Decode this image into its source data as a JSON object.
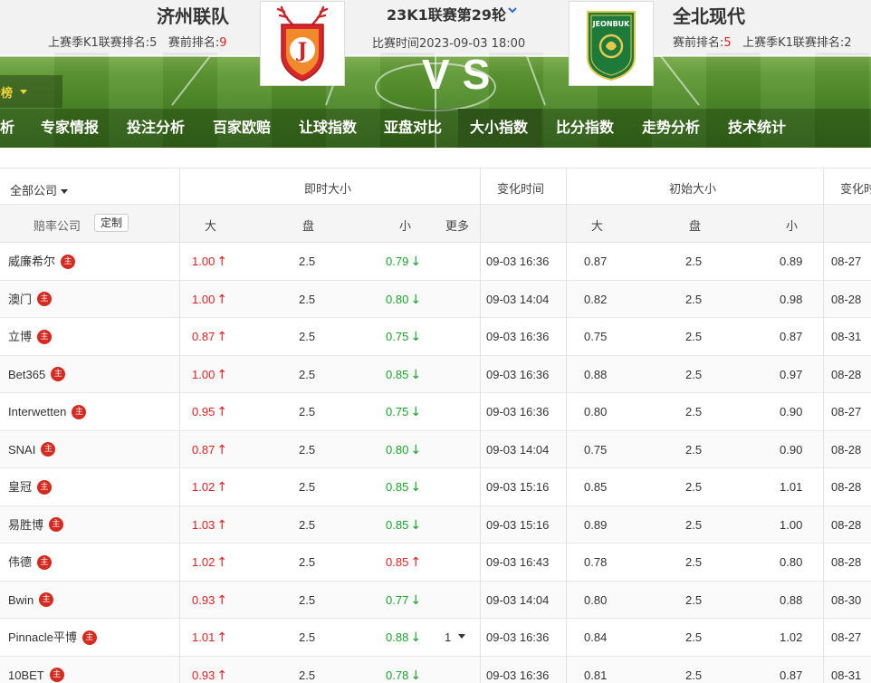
{
  "match": {
    "home_team": "济州联队",
    "away_team": "全北现代",
    "home_rank_prefix": "上赛季K1联赛排名:5",
    "home_rank_label": "赛前排名:",
    "home_rank_value": "9",
    "away_rank_label": "赛前排名:",
    "away_rank_value": "5",
    "away_rank_suffix": "上赛季K1联赛排名:2",
    "league_round": "23K1联赛第29轮",
    "match_time": "比赛时间2023-09-03 18:00",
    "vs": "VS",
    "home_logo_text": "J",
    "away_logo_text": "JEONBUK"
  },
  "rank_tab": {
    "label": "分榜"
  },
  "nav": {
    "items": [
      {
        "label": "析",
        "active": false
      },
      {
        "label": "专家情报",
        "active": false
      },
      {
        "label": "投注分析",
        "active": false
      },
      {
        "label": "百家欧赔",
        "active": false
      },
      {
        "label": "让球指数",
        "active": false
      },
      {
        "label": "亚盘对比",
        "active": false
      },
      {
        "label": "大小指数",
        "active": true
      },
      {
        "label": "比分指数",
        "active": false
      },
      {
        "label": "走势分析",
        "active": false
      },
      {
        "label": "技术统计",
        "active": false
      }
    ]
  },
  "table": {
    "company_filter": "全部公司",
    "live_header": "即时大小",
    "change_time_header": "变化时间",
    "initial_header": "初始大小",
    "initial_change_header": "变化时",
    "odds_company_label": "赔率公司",
    "customize_label": "定制",
    "sub_big": "大",
    "sub_line": "盘",
    "sub_small": "小",
    "sub_more": "更多",
    "sub_ibig": "大",
    "sub_iline": "盘",
    "sub_ismall": "小",
    "badge_label": "主",
    "rows": [
      {
        "company": "威廉希尔",
        "big": "1.00",
        "big_dir": "up",
        "line": "2.5",
        "small": "0.79",
        "small_dir": "down",
        "more": "",
        "time": "09-03 16:36",
        "ibig": "0.87",
        "iline": "2.5",
        "ismall": "0.89",
        "itime": "08-27"
      },
      {
        "company": "澳门",
        "big": "1.00",
        "big_dir": "up",
        "line": "2.5",
        "small": "0.80",
        "small_dir": "down",
        "more": "",
        "time": "09-03 14:04",
        "ibig": "0.82",
        "iline": "2.5",
        "ismall": "0.98",
        "itime": "08-28"
      },
      {
        "company": "立博",
        "big": "0.87",
        "big_dir": "up",
        "line": "2.5",
        "small": "0.75",
        "small_dir": "down",
        "more": "",
        "time": "09-03 16:36",
        "ibig": "0.75",
        "iline": "2.5",
        "ismall": "0.87",
        "itime": "08-31"
      },
      {
        "company": "Bet365",
        "big": "1.00",
        "big_dir": "up",
        "line": "2.5",
        "small": "0.85",
        "small_dir": "down",
        "more": "",
        "time": "09-03 16:36",
        "ibig": "0.88",
        "iline": "2.5",
        "ismall": "0.97",
        "itime": "08-28"
      },
      {
        "company": "Interwetten",
        "big": "0.95",
        "big_dir": "up",
        "line": "2.5",
        "small": "0.75",
        "small_dir": "down",
        "more": "",
        "time": "09-03 16:36",
        "ibig": "0.80",
        "iline": "2.5",
        "ismall": "0.90",
        "itime": "08-27"
      },
      {
        "company": "SNAI",
        "big": "0.87",
        "big_dir": "up",
        "line": "2.5",
        "small": "0.80",
        "small_dir": "down",
        "more": "",
        "time": "09-03 14:04",
        "ibig": "0.75",
        "iline": "2.5",
        "ismall": "0.90",
        "itime": "08-28"
      },
      {
        "company": "皇冠",
        "big": "1.02",
        "big_dir": "up",
        "line": "2.5",
        "small": "0.85",
        "small_dir": "down",
        "more": "",
        "time": "09-03 15:16",
        "ibig": "0.85",
        "iline": "2.5",
        "ismall": "1.01",
        "itime": "08-28"
      },
      {
        "company": "易胜博",
        "big": "1.03",
        "big_dir": "up",
        "line": "2.5",
        "small": "0.85",
        "small_dir": "down",
        "more": "",
        "time": "09-03 15:16",
        "ibig": "0.89",
        "iline": "2.5",
        "ismall": "1.00",
        "itime": "08-28"
      },
      {
        "company": "伟德",
        "big": "1.02",
        "big_dir": "up",
        "line": "2.5",
        "small": "0.85",
        "small_dir": "up",
        "more": "",
        "time": "09-03 16:43",
        "ibig": "0.78",
        "iline": "2.5",
        "ismall": "0.80",
        "itime": "08-28"
      },
      {
        "company": "Bwin",
        "big": "0.93",
        "big_dir": "up",
        "line": "2.5",
        "small": "0.77",
        "small_dir": "down",
        "more": "",
        "time": "09-03 14:04",
        "ibig": "0.80",
        "iline": "2.5",
        "ismall": "0.88",
        "itime": "08-30"
      },
      {
        "company": "Pinnacle平博",
        "big": "1.01",
        "big_dir": "up",
        "line": "2.5",
        "small": "0.88",
        "small_dir": "down",
        "more": "1",
        "time": "09-03 16:36",
        "ibig": "0.84",
        "iline": "2.5",
        "ismall": "1.02",
        "itime": "08-27"
      },
      {
        "company": "10BET",
        "big": "0.93",
        "big_dir": "up",
        "line": "2.5",
        "small": "0.78",
        "small_dir": "down",
        "more": "",
        "time": "09-03 16:36",
        "ibig": "0.81",
        "iline": "2.5",
        "ismall": "0.87",
        "itime": "08-31"
      }
    ]
  },
  "colors": {
    "up": "#e02020",
    "down": "#1aa329",
    "nav_active": "#2f5419",
    "rank_highlight": "#e02020",
    "home_red": "#d8262a",
    "away_green": "#1d7a3a"
  }
}
